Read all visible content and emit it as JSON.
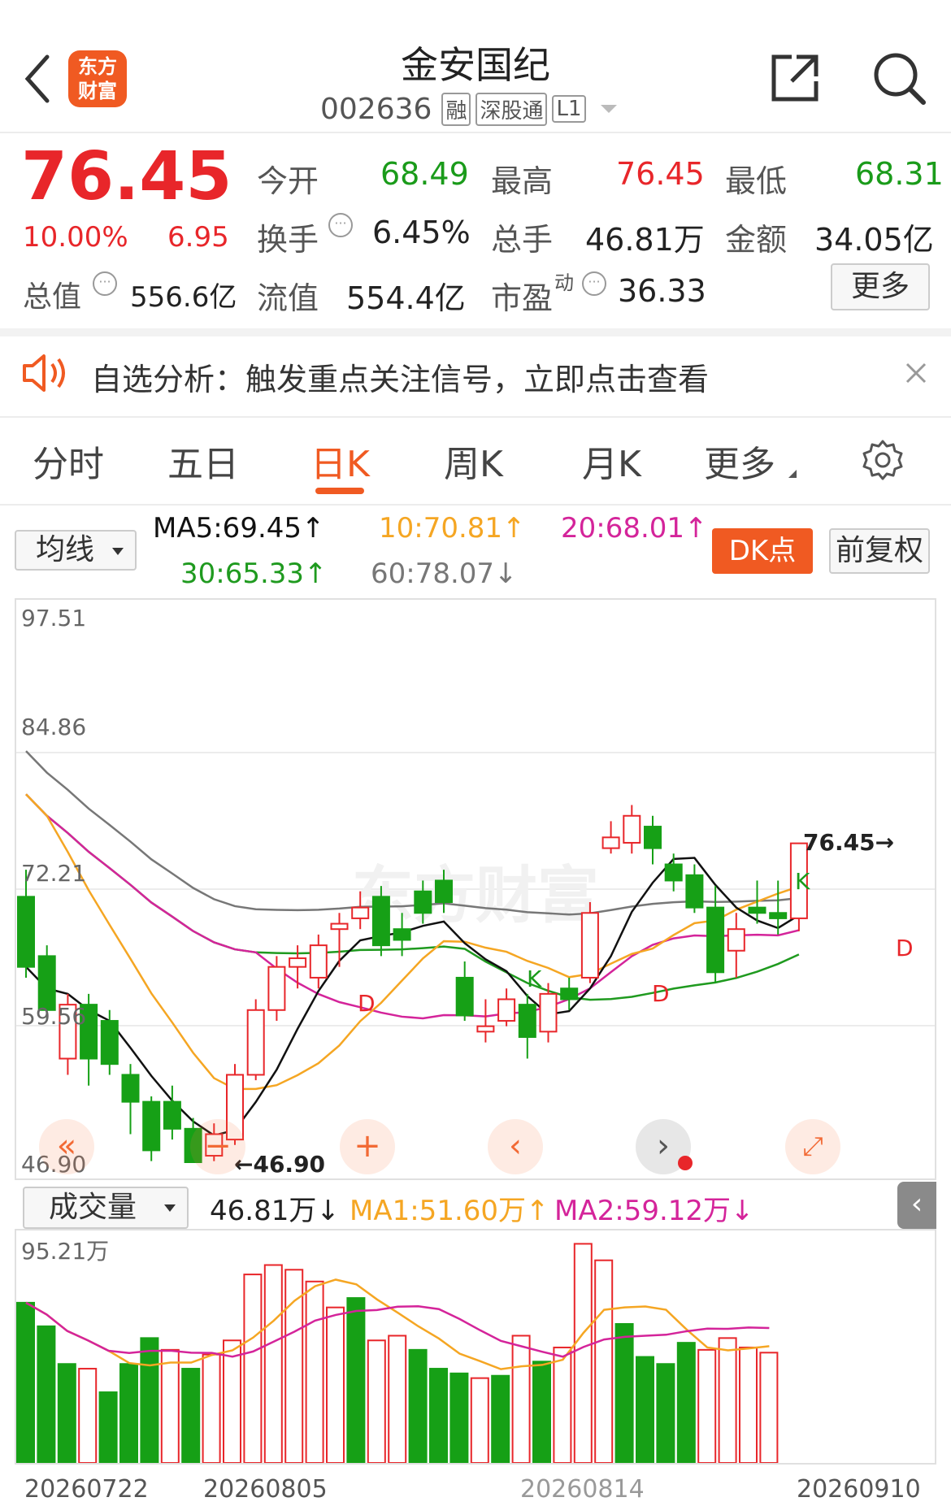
{
  "header": {
    "stock_name": "金安国纪",
    "stock_code": "002636",
    "tags": [
      "融",
      "深股通",
      "L1"
    ],
    "logo_line1": "东方",
    "logo_line2": "财富"
  },
  "quote": {
    "price": "76.45",
    "change_pct": "10.00%",
    "change_amt": "6.95",
    "total_value_label": "总值",
    "total_value": "556.6亿",
    "fields": [
      {
        "label": "今开",
        "value": "68.49"
      },
      {
        "label": "最高",
        "value": "76.45"
      },
      {
        "label": "最低",
        "value": "68.31"
      },
      {
        "label": "换手",
        "value": "6.45%"
      },
      {
        "label": "总手",
        "value": "46.81万"
      },
      {
        "label": "金额",
        "value": "34.05亿"
      },
      {
        "label": "流值",
        "value": "554.4亿"
      },
      {
        "label": "市盈",
        "value": "36.33"
      }
    ],
    "pe_sup": "动",
    "more_button": "更多"
  },
  "notice": {
    "text": "自选分析：触发重点关注信号，立即点击查看"
  },
  "tabs": [
    "分时",
    "五日",
    "日K",
    "周K",
    "月K",
    "更多"
  ],
  "ma_bar": {
    "selector": "均线",
    "ma5": "MA5:69.45↑",
    "ma10": "10:70.81↑",
    "ma20": "20:68.01↑",
    "ma30": "30:65.33↑",
    "ma60": "60:78.07↓",
    "dk_button": "DK点",
    "adjust_button": "前复权"
  },
  "colors": {
    "up": "#e8262a",
    "down": "#16a016",
    "ma5": "#111111",
    "ma10": "#f5a623",
    "ma20": "#d4249a",
    "ma30": "#1f9a1f",
    "ma60": "#777777",
    "accent": "#f05a22"
  },
  "watermark": "东方财富",
  "price_chart": {
    "y_labels": [
      "97.51",
      "84.86",
      "72.21",
      "59.56",
      "46.90"
    ],
    "low_marker": "46.90",
    "high_marker": "76.45",
    "signal_k": "K",
    "signal_d": "D"
  },
  "volume_bar": {
    "selector": "成交量",
    "vol": "46.81万↓",
    "ma1": "MA1:51.60万↑",
    "ma2": "MA2:59.12万↓",
    "y_top": "95.21万"
  },
  "x_labels": [
    "20260722",
    "20260805",
    "20260814",
    "20260910"
  ],
  "chart_data": {
    "type": "candlestick",
    "ylim": [
      46.9,
      97.51
    ],
    "candles": [
      {
        "o": 71.5,
        "c": 65.0,
        "h": 74.0,
        "l": 64.0
      },
      {
        "o": 66.0,
        "c": 61.0,
        "h": 67.0,
        "l": 60.0
      },
      {
        "o": 56.5,
        "c": 61.5,
        "h": 62.5,
        "l": 55.0
      },
      {
        "o": 61.5,
        "c": 56.5,
        "h": 62.5,
        "l": 54.0
      },
      {
        "o": 60.0,
        "c": 56.0,
        "h": 61.0,
        "l": 55.0
      },
      {
        "o": 55.0,
        "c": 52.5,
        "h": 56.0,
        "l": 49.5
      },
      {
        "o": 52.5,
        "c": 48.0,
        "h": 53.0,
        "l": 47.0
      },
      {
        "o": 52.5,
        "c": 50.0,
        "h": 54.0,
        "l": 49.0
      },
      {
        "o": 50.0,
        "c": 46.9,
        "h": 51.0,
        "l": 46.9
      },
      {
        "o": 47.5,
        "c": 49.5,
        "h": 50.5,
        "l": 47.0
      },
      {
        "o": 49.0,
        "c": 55.0,
        "h": 56.0,
        "l": 48.5
      },
      {
        "o": 55.0,
        "c": 61.0,
        "h": 62.0,
        "l": 54.5
      },
      {
        "o": 61.0,
        "c": 65.0,
        "h": 66.0,
        "l": 60.0
      },
      {
        "o": 65.0,
        "c": 65.8,
        "h": 67.0,
        "l": 63.0
      },
      {
        "o": 64.0,
        "c": 67.0,
        "h": 68.0,
        "l": 63.0
      },
      {
        "o": 68.5,
        "c": 69.0,
        "h": 70.0,
        "l": 65.0
      },
      {
        "o": 69.5,
        "c": 70.5,
        "h": 72.0,
        "l": 68.5
      },
      {
        "o": 71.5,
        "c": 67.0,
        "h": 72.5,
        "l": 66.0
      },
      {
        "o": 68.5,
        "c": 67.5,
        "h": 70.0,
        "l": 66.0
      },
      {
        "o": 72.0,
        "c": 70.0,
        "h": 73.0,
        "l": 69.0
      },
      {
        "o": 73.0,
        "c": 71.0,
        "h": 74.0,
        "l": 70.0
      },
      {
        "o": 64.0,
        "c": 60.5,
        "h": 65.5,
        "l": 60.0
      },
      {
        "o": 59.0,
        "c": 59.5,
        "h": 62.0,
        "l": 58.0
      },
      {
        "o": 60.0,
        "c": 62.0,
        "h": 63.0,
        "l": 59.5
      },
      {
        "o": 61.5,
        "c": 58.5,
        "h": 62.5,
        "l": 56.5
      },
      {
        "o": 59.0,
        "c": 62.5,
        "h": 63.5,
        "l": 58.0
      },
      {
        "o": 63.0,
        "c": 62.0,
        "h": 64.0,
        "l": 61.0
      },
      {
        "o": 64.0,
        "c": 70.0,
        "h": 71.0,
        "l": 63.5
      },
      {
        "o": 76.0,
        "c": 77.0,
        "h": 78.5,
        "l": 75.5
      },
      {
        "o": 76.5,
        "c": 79.0,
        "h": 80.0,
        "l": 75.5
      },
      {
        "o": 78.0,
        "c": 76.0,
        "h": 79.0,
        "l": 74.5
      },
      {
        "o": 74.5,
        "c": 73.0,
        "h": 75.5,
        "l": 72.0
      },
      {
        "o": 73.5,
        "c": 70.5,
        "h": 74.5,
        "l": 70.0
      },
      {
        "o": 70.5,
        "c": 64.5,
        "h": 72.5,
        "l": 63.5
      },
      {
        "o": 66.5,
        "c": 68.5,
        "h": 70.0,
        "l": 64.0
      },
      {
        "o": 70.5,
        "c": 70.0,
        "h": 73.0,
        "l": 69.0
      },
      {
        "o": 70.0,
        "c": 69.5,
        "h": 73.0,
        "l": 68.0
      },
      {
        "o": 69.5,
        "c": 76.45,
        "h": 76.45,
        "l": 68.31
      }
    ],
    "volume": {
      "ylim": [
        0,
        95.21
      ],
      "values": [
        {
          "v": 68,
          "up": false
        },
        {
          "v": 58,
          "up": false
        },
        {
          "v": 42,
          "up": false
        },
        {
          "v": 40,
          "up": true
        },
        {
          "v": 30,
          "up": false
        },
        {
          "v": 42,
          "up": false
        },
        {
          "v": 53,
          "up": false
        },
        {
          "v": 48,
          "up": true
        },
        {
          "v": 40,
          "up": false
        },
        {
          "v": 46,
          "up": true
        },
        {
          "v": 52,
          "up": true
        },
        {
          "v": 80,
          "up": true
        },
        {
          "v": 84,
          "up": true
        },
        {
          "v": 82,
          "up": true
        },
        {
          "v": 77,
          "up": true
        },
        {
          "v": 66,
          "up": true
        },
        {
          "v": 70,
          "up": false
        },
        {
          "v": 52,
          "up": true
        },
        {
          "v": 54,
          "up": true
        },
        {
          "v": 48,
          "up": false
        },
        {
          "v": 40,
          "up": false
        },
        {
          "v": 38,
          "up": false
        },
        {
          "v": 36,
          "up": true
        },
        {
          "v": 37,
          "up": false
        },
        {
          "v": 54,
          "up": true
        },
        {
          "v": 43,
          "up": false
        },
        {
          "v": 49,
          "up": true
        },
        {
          "v": 93,
          "up": true
        },
        {
          "v": 86,
          "up": true
        },
        {
          "v": 59,
          "up": false
        },
        {
          "v": 45,
          "up": false
        },
        {
          "v": 42,
          "up": false
        },
        {
          "v": 51,
          "up": false
        },
        {
          "v": 48,
          "up": true
        },
        {
          "v": 53,
          "up": true
        },
        {
          "v": 49,
          "up": true
        },
        {
          "v": 46.81,
          "up": true
        }
      ]
    }
  }
}
